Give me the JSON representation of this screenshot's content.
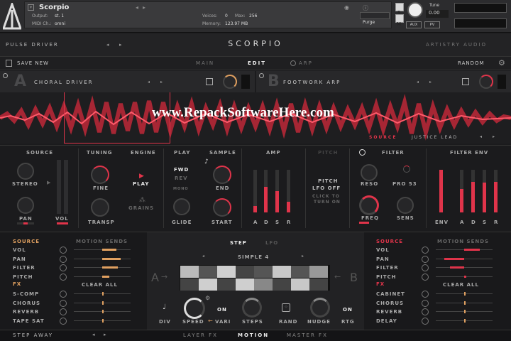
{
  "header": {
    "instrument_name": "Scorpio",
    "output_label": "Output:",
    "output_value": "st. 1",
    "midi_label": "MIDI Ch.:",
    "midi_value": "omni",
    "voices_label": "Voices:",
    "voices_value": "0",
    "max_label": "Max:",
    "max_value": "256",
    "memory_label": "Memory:",
    "memory_value": "123.97 MB",
    "purge_label": "Purge",
    "tune_label": "Tune",
    "tune_value": "0.00",
    "s_label": "S",
    "m_label": "M",
    "aux_label": "AUX",
    "pv_label": "PV"
  },
  "topbar": {
    "left_title": "PULSE DRIVER",
    "center_title": "SCORPIO",
    "right_title": "ARTISTRY AUDIO"
  },
  "menubar": {
    "save_new": "SAVE NEW",
    "tab_main": "MAIN",
    "tab_edit": "EDIT",
    "tab_arp": "ARP",
    "random": "RANDOM"
  },
  "layers": {
    "a_letter": "A",
    "a_name": "CHORAL DRIVER",
    "b_letter": "B",
    "b_name": "FOOTWORK ARP"
  },
  "waveform": {
    "watermark": "www.RepackSoftwareHere.com",
    "source_label": "SOURCE",
    "source_value": "JUSTICE LEAD"
  },
  "sections": {
    "source": "SOURCE",
    "tuning": "TUNING",
    "engine": "ENGINE",
    "play": "PLAY",
    "sample": "SAMPLE",
    "amp": "AMP",
    "pitch": "PITCH",
    "filter": "FILTER",
    "filter_env": "FILTER ENV"
  },
  "controls": {
    "stereo": "STEREO",
    "pan": "PAN",
    "vol": "VOL",
    "fine": "FINE",
    "transp": "TRANSP",
    "play": "PLAY",
    "grains": "GRAINS",
    "fwd": "FWD",
    "rev": "REV",
    "mono": "MONO",
    "glide": "GLIDE",
    "end": "END",
    "start": "START",
    "amp_a": "A",
    "amp_d": "D",
    "amp_s": "S",
    "amp_r": "R",
    "pitch_lfo_1": "PITCH",
    "pitch_lfo_2": "LFO OFF",
    "click_1": "CLICK TO",
    "click_2": "TURN ON",
    "reso": "RESO",
    "pro53": "PRO 53",
    "freq": "FREQ",
    "sens": "SENS",
    "env": "ENV",
    "fenv_a": "A",
    "fenv_d": "D",
    "fenv_s": "S",
    "fenv_r": "R"
  },
  "mod_left": {
    "source": "SOURCE",
    "motion_sends": "MOTION SENDS",
    "rows": [
      "VOL",
      "PAN",
      "FILTER",
      "PITCH"
    ],
    "fx": "FX",
    "fx_rows": [
      "S-COMP",
      "CHORUS",
      "REVERB",
      "TAPE SAT"
    ],
    "clear_all": "CLEAR ALL",
    "send_levels": [
      0.5,
      0.65,
      0.55,
      0.25
    ]
  },
  "mod_right": {
    "source": "SOURCE",
    "motion_sends": "MOTION SENDS",
    "rows": [
      "VOL",
      "PAN",
      "FILTER",
      "PITCH"
    ],
    "fx": "FX",
    "fx_rows": [
      "CABINET",
      "CHORUS",
      "REVERB",
      "DELAY"
    ],
    "clear_all": "CLEAR ALL",
    "send_levels": [
      0.55,
      -0.7,
      -0.5,
      0.05
    ]
  },
  "sequencer": {
    "tab_step": "STEP",
    "tab_lfo": "LFO",
    "pattern": "SIMPLE 4",
    "a_label": "A",
    "b_label": "B",
    "div": "DIV",
    "speed": "SPEED",
    "vari": "VARI",
    "on1": "ON",
    "steps": "STEPS",
    "rand": "RAND",
    "nudge": "NUDGE",
    "on2": "ON",
    "rtg": "RTG"
  },
  "bottom": {
    "preset": "STEP AWAY",
    "tab_layer_fx": "LAYER FX",
    "tab_motion": "MOTION",
    "tab_master_fx": "MASTER FX"
  },
  "colors": {
    "accent": "#e0344a",
    "orange": "#e0a060",
    "bg": "#1b1b1d"
  }
}
